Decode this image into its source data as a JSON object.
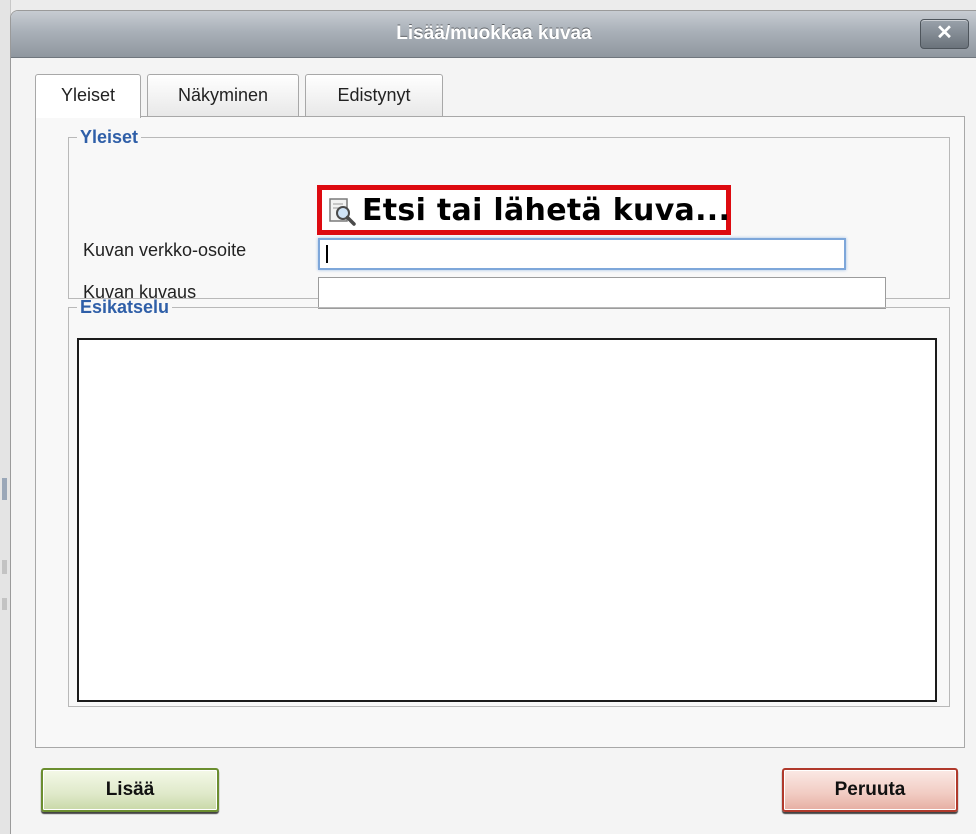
{
  "dialog": {
    "title": "Lisää/muokkaa kuvaa",
    "close_label": "✕"
  },
  "tabs": [
    {
      "label": "Yleiset",
      "active": true
    },
    {
      "label": "Näkyminen",
      "active": false
    },
    {
      "label": "Edistynyt",
      "active": false
    }
  ],
  "general": {
    "legend": "Yleiset",
    "browse_label": "Etsi tai lähetä kuva...",
    "browse_icon": "magnifier-document-icon",
    "image_url_label": "Kuvan verkko-osoite",
    "image_url_value": "",
    "image_desc_label": "Kuvan kuvaus",
    "image_desc_value": ""
  },
  "preview": {
    "legend": "Esikatselu"
  },
  "footer": {
    "insert_label": "Lisää",
    "cancel_label": "Peruuta"
  },
  "colors": {
    "legend_text": "#2f5fa8",
    "highlight_border": "#dd0a10",
    "insert_border": "#6b8e2f",
    "cancel_border": "#b0392b"
  }
}
